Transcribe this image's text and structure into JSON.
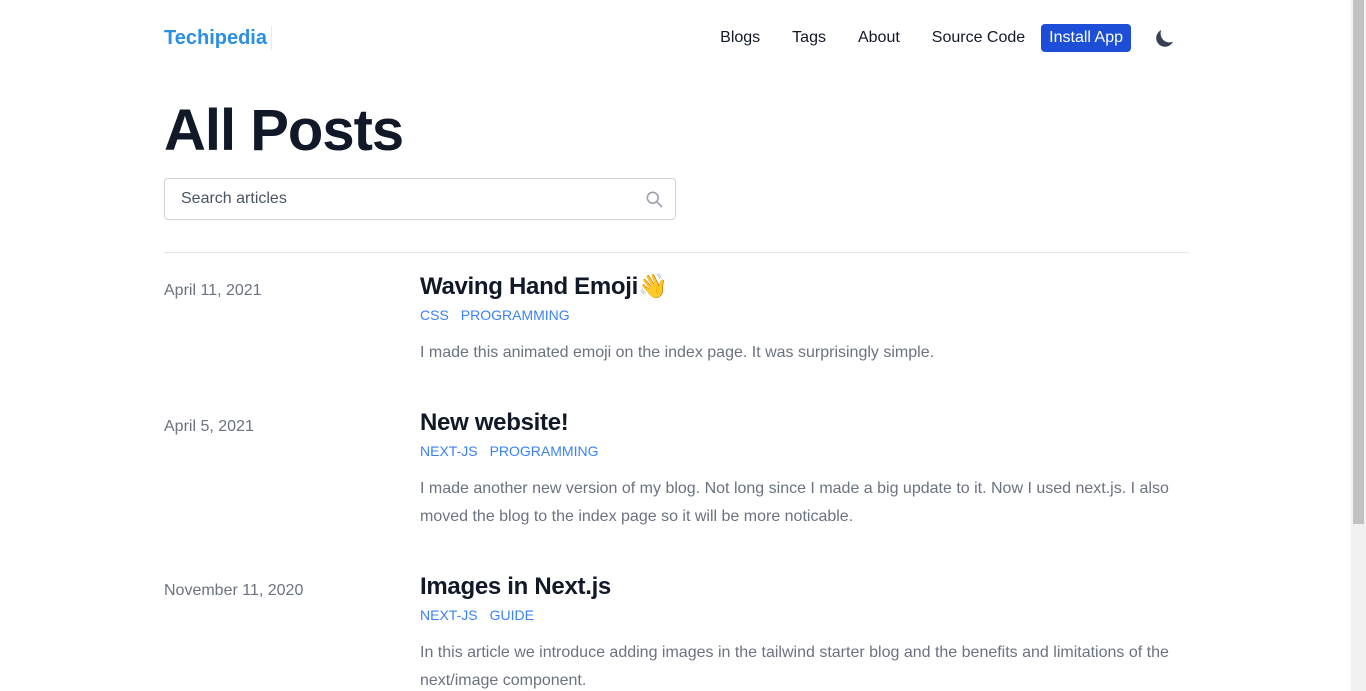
{
  "header": {
    "logo": "Techipedia",
    "nav": [
      "Blogs",
      "Tags",
      "About",
      "Source Code"
    ],
    "install_label": "Install App",
    "theme_icon": "moon-icon"
  },
  "main": {
    "title": "All Posts",
    "search_placeholder": "Search articles"
  },
  "posts": [
    {
      "date": "April 11, 2021",
      "title": "Waving Hand Emoji👋",
      "tags": [
        "CSS",
        "PROGRAMMING"
      ],
      "summary": "I made this animated emoji on the index page. It was surprisingly simple."
    },
    {
      "date": "April 5, 2021",
      "title": "New website!",
      "tags": [
        "NEXT-JS",
        "PROGRAMMING"
      ],
      "summary": "I made another new version of my blog. Not long since I made a big update to it. Now I used next.js. I also moved the blog to the index page so it will be more noticable."
    },
    {
      "date": "November 11, 2020",
      "title": "Images in Next.js",
      "tags": [
        "NEXT-JS",
        "GUIDE"
      ],
      "summary": "In this article we introduce adding images in the tailwind starter blog and the benefits and limitations of the next/image component."
    }
  ],
  "colors": {
    "accent": "#2b8fe4",
    "button": "#1d4ed8",
    "tag": "#3b82f6",
    "muted": "#6b7280"
  }
}
